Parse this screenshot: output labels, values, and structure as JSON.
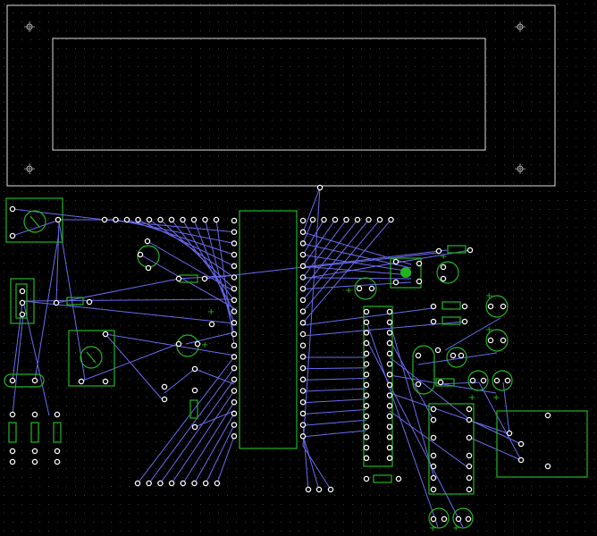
{
  "colors": {
    "background": "#000000",
    "grid_dot": "#3d3d3d",
    "silkscreen": "#ffffff",
    "component_outline": "#22b522",
    "ratsnest": "#6a6af0",
    "pad": "#ffffff"
  },
  "components": [
    {
      "kind": "lcd-module",
      "label": ""
    },
    {
      "kind": "microcontroller-dip40",
      "label": ""
    },
    {
      "kind": "ic-dip16",
      "label": ""
    },
    {
      "kind": "potentiometer",
      "label": ""
    },
    {
      "kind": "potentiometer",
      "label": ""
    },
    {
      "kind": "push-button",
      "label": ""
    },
    {
      "kind": "crystal",
      "label": ""
    },
    {
      "kind": "relay",
      "label": ""
    },
    {
      "kind": "connector",
      "label": ""
    }
  ]
}
